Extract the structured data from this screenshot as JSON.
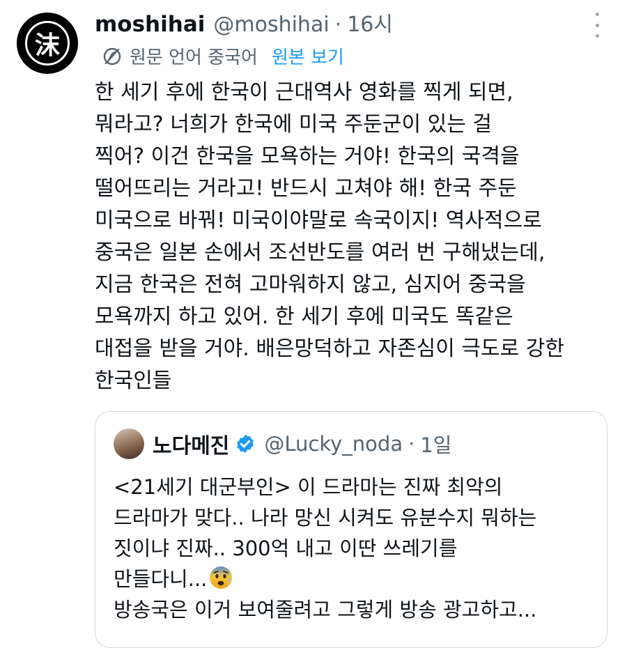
{
  "tweet": {
    "display_name": "moshihai",
    "handle": "@moshihai",
    "separator": "·",
    "time": "16시",
    "avatar_glyph": "沫",
    "translation": {
      "source_language": "원문 언어 중국어",
      "view_original": "원본 보기"
    },
    "body_lines": [
      "한 세기 후에 한국이 근대역사 영화를 찍게 되면,",
      "뭐라고? 너희가 한국에 미국 주둔군이 있는 걸",
      "찍어? 이건 한국을 모욕하는 거야! 한국의 국격을",
      "떨어뜨리는 거라고! 반드시 고쳐야 해! 한국 주둔",
      "미국으로 바꿔! 미국이야말로 속국이지! 역사적으로",
      "중국은 일본 손에서 조선반도를 여러 번 구해냈는데,",
      "지금 한국은 전혀 고마워하지 않고, 심지어 중국을",
      "모욕까지 하고 있어. 한 세기 후에 미국도 똑같은",
      "대접을 받을 거야. 배은망덕하고 자존심이 극도로 강한",
      "한국인들"
    ]
  },
  "quoted": {
    "display_name": "노다메진",
    "handle": "@Lucky_noda",
    "separator": "·",
    "time": "1일",
    "body_lines": [
      "<21세기 대군부인> 이 드라마는 진짜 최악의",
      "드라마가 맞다.. 나라 망신 시켜도 유분수지 뭐하는",
      "짓이냐 진짜.. 300억 내고 이딴 쓰레기를",
      "만들다니...",
      "방송국은 이거 보여줄려고 그렇게 방송 광고하고..."
    ],
    "emoji": "fearful-face"
  },
  "icons": {
    "more": "more-vertical-icon",
    "translate": "translate-icon",
    "verified": "verified-badge-icon"
  },
  "colors": {
    "text": "#0f1419",
    "secondary": "#536471",
    "link": "#1d9bf0",
    "border": "#cfd9de"
  }
}
